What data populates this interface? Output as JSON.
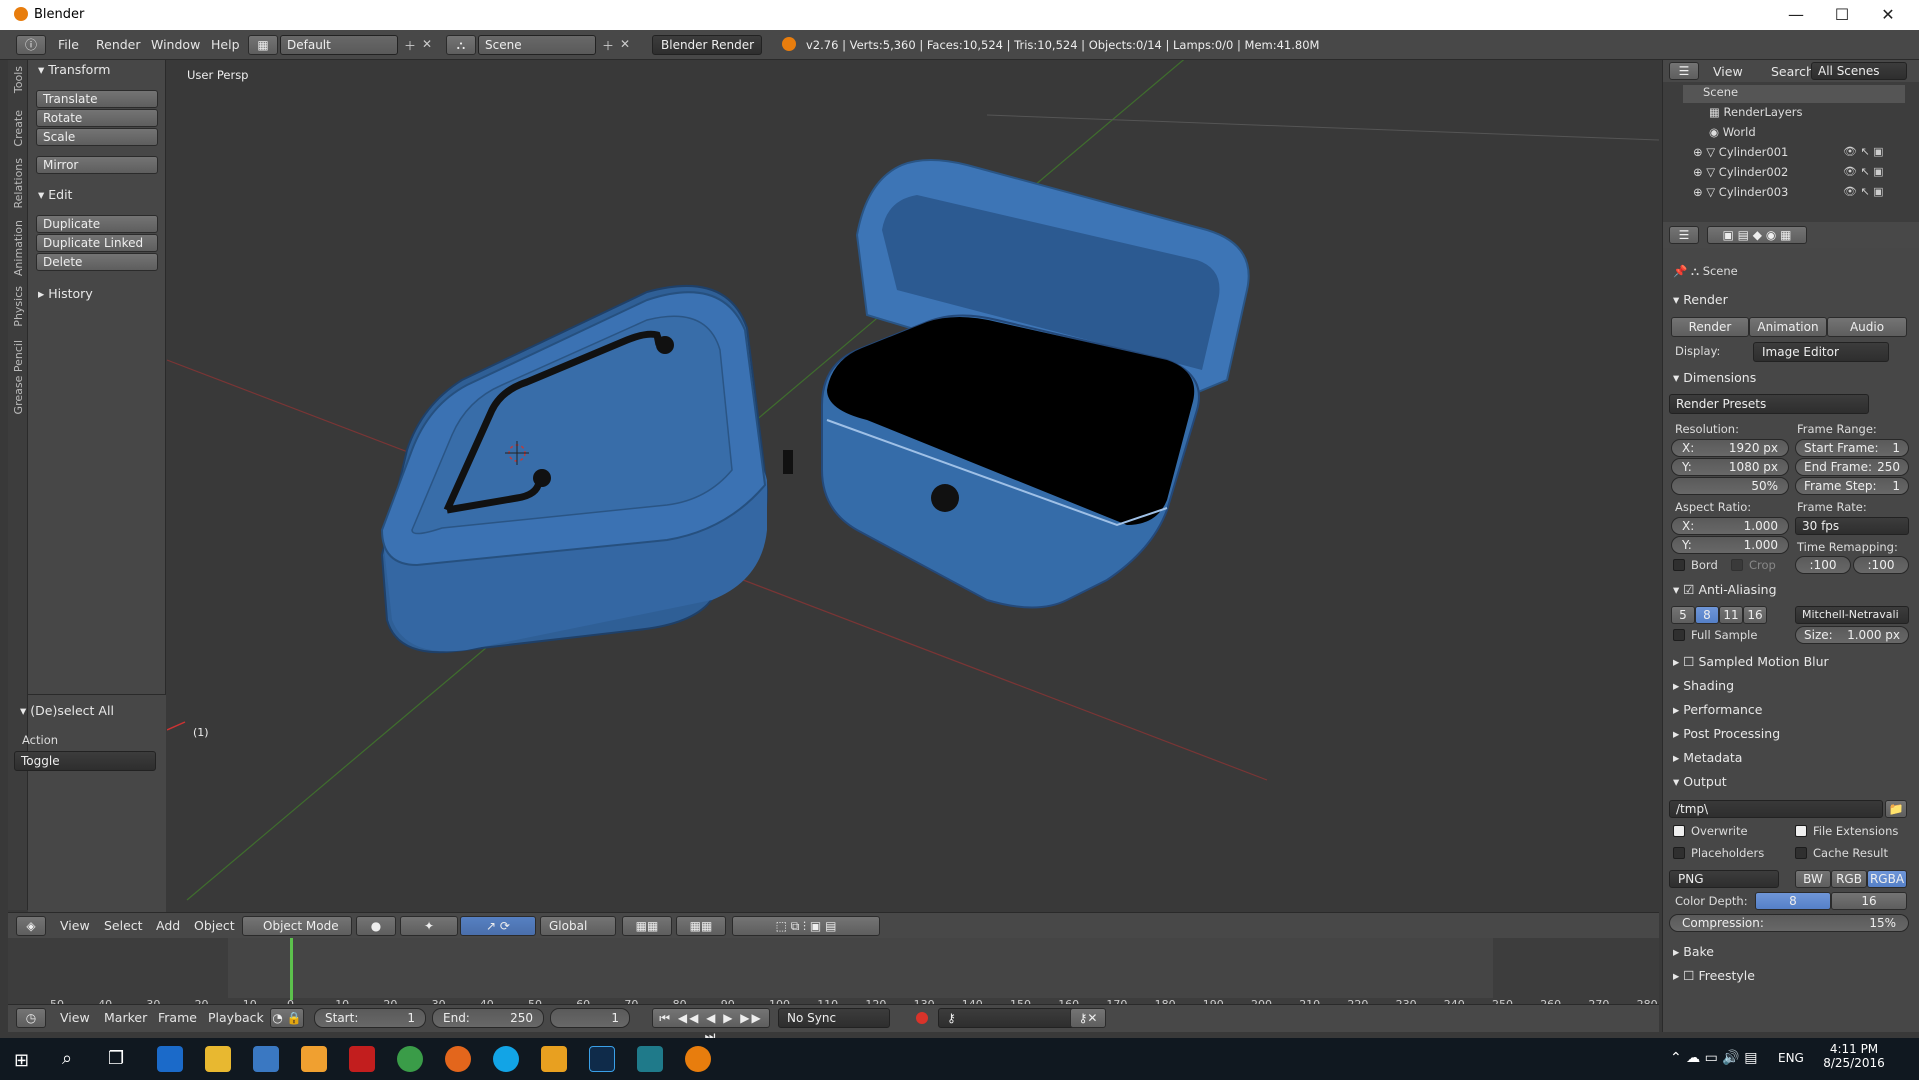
{
  "window": {
    "title": "Blender",
    "minimize": "—",
    "maximize": "☐",
    "close": "✕"
  },
  "topbar": {
    "menus": [
      "File",
      "Render",
      "Window",
      "Help"
    ],
    "layout": "Default",
    "scene": "Scene",
    "engine": "Blender Render",
    "stats": "v2.76 | Verts:5,360 | Faces:10,524 | Tris:10,524 | Objects:0/14 | Lamps:0/0 | Mem:41.80M"
  },
  "tool_tabs": [
    "Tools",
    "Create",
    "Relations",
    "Animation",
    "Physics",
    "Grease Pencil"
  ],
  "tools": {
    "transform_title": "Transform",
    "transform_buttons": [
      "Translate",
      "Rotate",
      "Scale"
    ],
    "mirror": "Mirror",
    "edit_title": "Edit",
    "edit_buttons": [
      "Duplicate",
      "Duplicate Linked",
      "Delete"
    ],
    "history_title": "History",
    "operator_title": "(De)select All",
    "action_label": "Action",
    "action_value": "Toggle"
  },
  "viewport": {
    "persp_label": "User Persp",
    "frame_label": "(1)"
  },
  "view3d_header": {
    "menus": [
      "View",
      "Select",
      "Add",
      "Object"
    ],
    "mode": "Object Mode",
    "orientation": "Global"
  },
  "timeline": {
    "ticks": [
      "-50",
      "-40",
      "-30",
      "-20",
      "-10",
      "0",
      "10",
      "20",
      "30",
      "40",
      "50",
      "60",
      "70",
      "80",
      "90",
      "100",
      "110",
      "120",
      "130",
      "140",
      "150",
      "160",
      "170",
      "180",
      "190",
      "200",
      "210",
      "220",
      "230",
      "240",
      "250",
      "260",
      "270",
      "280"
    ],
    "current_frame": 1
  },
  "timeline_header": {
    "menus": [
      "View",
      "Marker",
      "Frame",
      "Playback"
    ],
    "start": "Start:",
    "start_val": "1",
    "end": "End:",
    "end_val": "250",
    "current": "1",
    "sync": "No Sync"
  },
  "outliner": {
    "view": "View",
    "search": "Search",
    "filter": "All Scenes",
    "items": [
      "Scene",
      "RenderLayers",
      "World",
      "Cylinder001",
      "Cylinder002",
      "Cylinder003"
    ]
  },
  "properties": {
    "context": "Scene",
    "render_title": "Render",
    "render_buttons": [
      "Render",
      "Animation",
      "Audio"
    ],
    "display_label": "Display:",
    "display_value": "Image Editor",
    "dimensions_title": "Dimensions",
    "presets": "Render Presets",
    "resolution_label": "Resolution:",
    "res_x": "X:",
    "res_x_val": "1920 px",
    "res_y": "Y:",
    "res_y_val": "1080 px",
    "res_pct": "50%",
    "frame_range_label": "Frame Range:",
    "start_frame": "Start Frame:",
    "start_frame_val": "1",
    "end_frame": "End Frame:",
    "end_frame_val": "250",
    "frame_step": "Frame Step:",
    "frame_step_val": "1",
    "aspect_label": "Aspect Ratio:",
    "asp_x": "X:",
    "asp_x_val": "1.000",
    "asp_y": "Y:",
    "asp_y_val": "1.000",
    "frame_rate_label": "Frame Rate:",
    "frame_rate": "30 fps",
    "time_remap_label": "Time Remapping:",
    "remap_old": ":100",
    "remap_new": ":100",
    "bord": "Bord",
    "crop": "Crop",
    "aa_title": "Anti-Aliasing",
    "aa_samples": [
      "5",
      "8",
      "11",
      "16"
    ],
    "aa_filter": "Mitchell-Netravali",
    "full_sample": "Full Sample",
    "size_label": "Size:",
    "size_val": "1.000 px",
    "collapsed": [
      "Sampled Motion Blur",
      "Shading",
      "Performance",
      "Post Processing",
      "Metadata"
    ],
    "output_title": "Output",
    "output_path": "/tmp\\",
    "overwrite": "Overwrite",
    "file_ext": "File Extensions",
    "placeholders": "Placeholders",
    "cache": "Cache Result",
    "format": "PNG",
    "color_modes": [
      "BW",
      "RGB",
      "RGBA"
    ],
    "depth_label": "Color Depth:",
    "depth_8": "8",
    "depth_16": "16",
    "compression_label": "Compression:",
    "compression_val": "15%",
    "bake": "Bake",
    "freestyle": "Freestyle"
  },
  "taskbar": {
    "lang": "ENG",
    "time": "4:11 PM",
    "date": "8/25/2016"
  }
}
